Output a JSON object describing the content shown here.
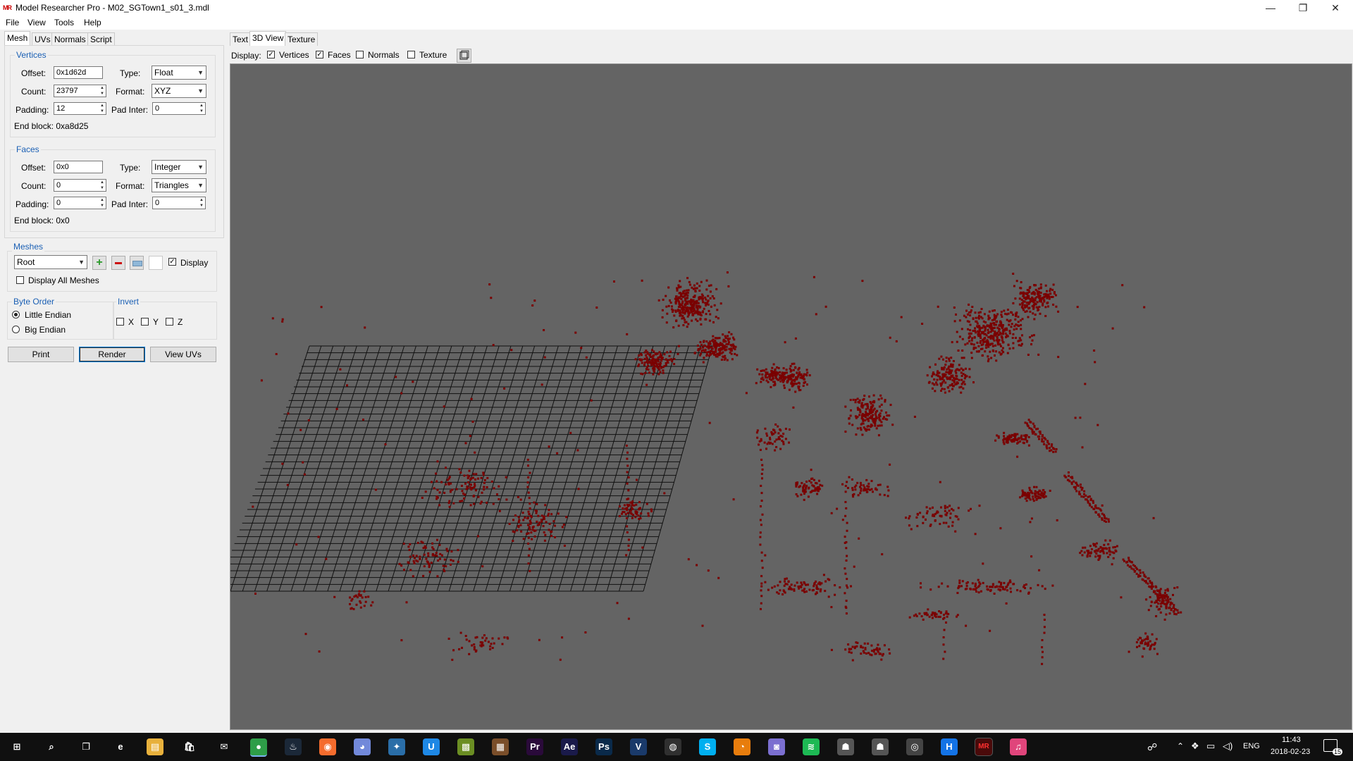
{
  "window": {
    "logo_text": "MR",
    "title": "Model Researcher Pro - M02_SGTown1_s01_3.mdl",
    "controls": {
      "minimize": "—",
      "maximize": "❐",
      "close": "✕"
    }
  },
  "menu": [
    "File",
    "View",
    "Tools",
    "Help"
  ],
  "left_tabs": [
    "Mesh",
    "UVs",
    "Normals",
    "Script"
  ],
  "right_tabs": [
    "Text",
    "3D View",
    "Texture"
  ],
  "vertices": {
    "legend": "Vertices",
    "offset_label": "Offset:",
    "offset": "0x1d62d",
    "type_label": "Type:",
    "type": "Float",
    "count_label": "Count:",
    "count": "23797",
    "format_label": "Format:",
    "format": "XYZ",
    "padding_label": "Padding:",
    "padding": "12",
    "padinter_label": "Pad Inter:",
    "padinter": "0",
    "endblock": "End block: 0xa8d25"
  },
  "faces": {
    "legend": "Faces",
    "offset_label": "Offset:",
    "offset": "0x0",
    "type_label": "Type:",
    "type": "Integer",
    "count_label": "Count:",
    "count": "0",
    "format_label": "Format:",
    "format": "Triangles",
    "padding_label": "Padding:",
    "padding": "0",
    "padinter_label": "Pad Inter:",
    "padinter": "0",
    "endblock": "End block: 0x0"
  },
  "meshes": {
    "legend": "Meshes",
    "selected": "Root",
    "display_label": "Display",
    "display_checked": true,
    "display_all_label": "Display All Meshes",
    "display_all_checked": false
  },
  "byte_order": {
    "legend": "Byte Order",
    "options": [
      "Little Endian",
      "Big Endian"
    ],
    "selected": "Little Endian"
  },
  "invert": {
    "legend": "Invert",
    "x": "X",
    "y": "Y",
    "z": "Z"
  },
  "buttons": {
    "print": "Print",
    "render": "Render",
    "view_uvs": "View UVs"
  },
  "display_bar": {
    "label": "Display:",
    "vertices": "Vertices",
    "vertices_checked": true,
    "faces": "Faces",
    "faces_checked": true,
    "normals": "Normals",
    "normals_checked": false,
    "texture": "Texture",
    "texture_checked": false
  },
  "colors": {
    "viewport_bg": "#646464",
    "point_color": "#7a0000",
    "grid_line": "#111111",
    "accent": "#1a5fb4"
  },
  "taskbar": {
    "apps": [
      "windows-icon",
      "search-icon",
      "task-view-icon",
      "edge-icon",
      "file-explorer-icon",
      "store-icon",
      "mail-icon",
      "chrome-icon",
      "steam-icon",
      "origin-icon",
      "discord-icon",
      "blender-icon",
      "uplay-icon",
      "minecraft-icon",
      "terraria-icon",
      "premiere-icon",
      "after-effects-icon",
      "photoshop-icon",
      "vegas-icon",
      "davinci-icon",
      "skype-icon",
      "blender-2-icon",
      "notification-app-icon",
      "spotify-icon",
      "gimp-icon",
      "gimp-2-icon",
      "obs-icon",
      "hotkey-icon",
      "model-researcher-icon",
      "itunes-icon"
    ],
    "app_labels": {
      "premiere": "Pr",
      "after_effects": "Ae",
      "photoshop": "Ps",
      "vegas": "V",
      "skype": "S",
      "hotkey": "H",
      "edge": "e"
    },
    "language": "ENG",
    "time": "11:43",
    "date": "2018-02-23",
    "notifications": "15"
  }
}
